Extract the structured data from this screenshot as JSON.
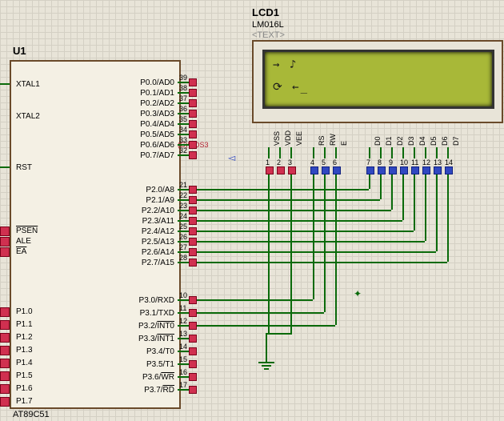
{
  "u1": {
    "ref": "U1",
    "part": "AT89C51",
    "left_pins": [
      {
        "name": "XTAL1"
      },
      {
        "name": "XTAL2"
      },
      {
        "name": "RST"
      },
      {
        "name": "PSEN",
        "over": true
      },
      {
        "name": "ALE"
      },
      {
        "name": "EA",
        "over": true
      },
      {
        "name": "P1.0"
      },
      {
        "name": "P1.1"
      },
      {
        "name": "P1.2"
      },
      {
        "name": "P1.3"
      },
      {
        "name": "P1.4"
      },
      {
        "name": "P1.5"
      },
      {
        "name": "P1.6"
      },
      {
        "name": "P1.7"
      }
    ],
    "right_pins": [
      {
        "name": "P0.0/AD0",
        "num": "39"
      },
      {
        "name": "P0.1/AD1",
        "num": "38"
      },
      {
        "name": "P0.2/AD2",
        "num": "37"
      },
      {
        "name": "P0.3/AD3",
        "num": "36"
      },
      {
        "name": "P0.4/AD4",
        "num": "35"
      },
      {
        "name": "P0.5/AD5",
        "num": "34"
      },
      {
        "name": "P0.6/AD6",
        "num": "33"
      },
      {
        "name": "P0.7/AD7",
        "num": "32"
      },
      {
        "name": "P2.0/A8",
        "num": "21"
      },
      {
        "name": "P2.1/A9",
        "num": "22"
      },
      {
        "name": "P2.2/A10",
        "num": "23"
      },
      {
        "name": "P2.3/A11",
        "num": "24"
      },
      {
        "name": "P2.4/A12",
        "num": "25"
      },
      {
        "name": "P2.5/A13",
        "num": "26"
      },
      {
        "name": "P2.6/A14",
        "num": "27"
      },
      {
        "name": "P2.7/A15",
        "num": "28"
      },
      {
        "name": "P3.0/RXD",
        "num": "10"
      },
      {
        "name": "P3.1/TXD",
        "num": "11"
      },
      {
        "name": "P3.2/INT0",
        "num": "12",
        "over_part": "INT0"
      },
      {
        "name": "P3.3/INT1",
        "num": "13",
        "over_part": "INT1"
      },
      {
        "name": "P3.4/T0",
        "num": "14"
      },
      {
        "name": "P3.5/T1",
        "num": "15"
      },
      {
        "name": "P3.6/WR",
        "num": "16",
        "over_part": "WR"
      },
      {
        "name": "P3.7/RD",
        "num": "17",
        "over_part": "RD"
      }
    ]
  },
  "lcd": {
    "ref": "LCD1",
    "part": "LM016L",
    "text_placeholder": "<TEXT>",
    "line1": "→  ♪",
    "line2": "⟳  ←_",
    "pins": [
      {
        "lbl": "VSS",
        "num": "1"
      },
      {
        "lbl": "VDD",
        "num": "2"
      },
      {
        "lbl": "VEE",
        "num": "3"
      },
      {
        "lbl": "RS",
        "num": "4"
      },
      {
        "lbl": "RW",
        "num": "5"
      },
      {
        "lbl": "E",
        "num": "6"
      },
      {
        "lbl": "D0",
        "num": "7"
      },
      {
        "lbl": "D1",
        "num": "8"
      },
      {
        "lbl": "D2",
        "num": "9"
      },
      {
        "lbl": "D3",
        "num": "10"
      },
      {
        "lbl": "D4",
        "num": "11"
      },
      {
        "lbl": "D5",
        "num": "12"
      },
      {
        "lbl": "D6",
        "num": "13"
      },
      {
        "lbl": "D7",
        "num": "14"
      }
    ]
  },
  "annotation": "(C)V-DS3",
  "chart_data": {
    "type": "schematic",
    "components": [
      {
        "ref": "U1",
        "part": "AT89C51",
        "kind": "microcontroller"
      },
      {
        "ref": "LCD1",
        "part": "LM016L",
        "kind": "lcd_16x2"
      }
    ],
    "nets": [
      {
        "from": "U1.P2.0",
        "to": "LCD1.D0"
      },
      {
        "from": "U1.P2.1",
        "to": "LCD1.D1"
      },
      {
        "from": "U1.P2.2",
        "to": "LCD1.D2"
      },
      {
        "from": "U1.P2.3",
        "to": "LCD1.D3"
      },
      {
        "from": "U1.P2.4",
        "to": "LCD1.D4"
      },
      {
        "from": "U1.P2.5",
        "to": "LCD1.D5"
      },
      {
        "from": "U1.P2.6",
        "to": "LCD1.D6"
      },
      {
        "from": "U1.P2.7",
        "to": "LCD1.D7"
      },
      {
        "from": "U1.P3.0",
        "to": "LCD1.RS"
      },
      {
        "from": "U1.P3.1",
        "to": "LCD1.RW"
      },
      {
        "from": "U1.P3.2",
        "to": "LCD1.E"
      },
      {
        "from": "LCD1.VSS",
        "to": "GND"
      },
      {
        "from": "LCD1.VEE",
        "to": "GND"
      }
    ]
  }
}
